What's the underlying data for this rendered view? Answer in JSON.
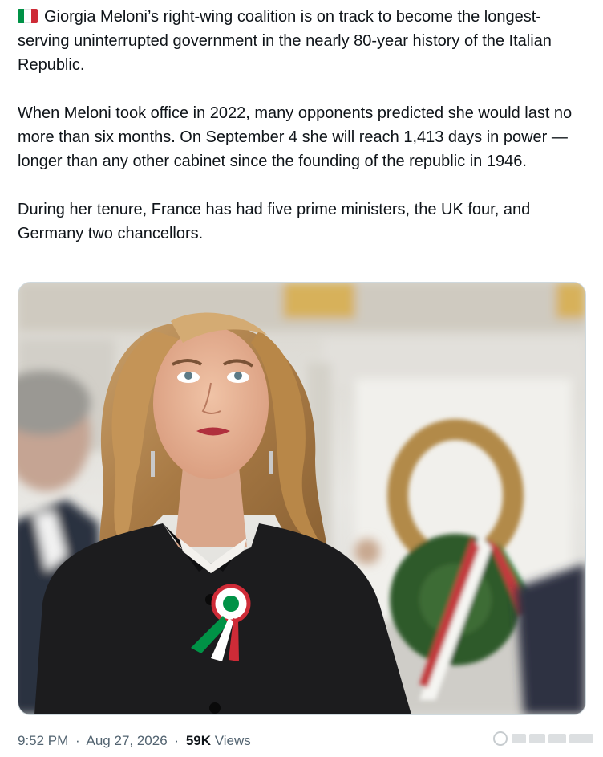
{
  "tweet": {
    "flag_icon": "italy-flag-emoji",
    "flag_colors": {
      "green": "#009246",
      "white": "#ffffff",
      "red": "#ce2b37"
    },
    "paragraph1": "Giorgia Meloni’s right-wing coalition is on track to become the longest-serving uninterrupted government in the nearly 80-year history of the Italian Republic.",
    "paragraph2": "When Meloni took office in 2022, many opponents predicted she would last no more than six months. On September 4 she will reach 1,413 days in power — longer than any other cabinet since the founding of the republic in 1946.",
    "paragraph3": "During her tenure, France has had five prime ministers, the UK four, and Germany two chancellors."
  },
  "meta": {
    "time": "9:52 PM",
    "separator": "·",
    "date": "Aug 27, 2026",
    "views_count": "59K",
    "views_label": "Views"
  },
  "colors": {
    "text": "#0f1419",
    "secondary_text": "#536471",
    "media_border": "#cfd9de"
  }
}
